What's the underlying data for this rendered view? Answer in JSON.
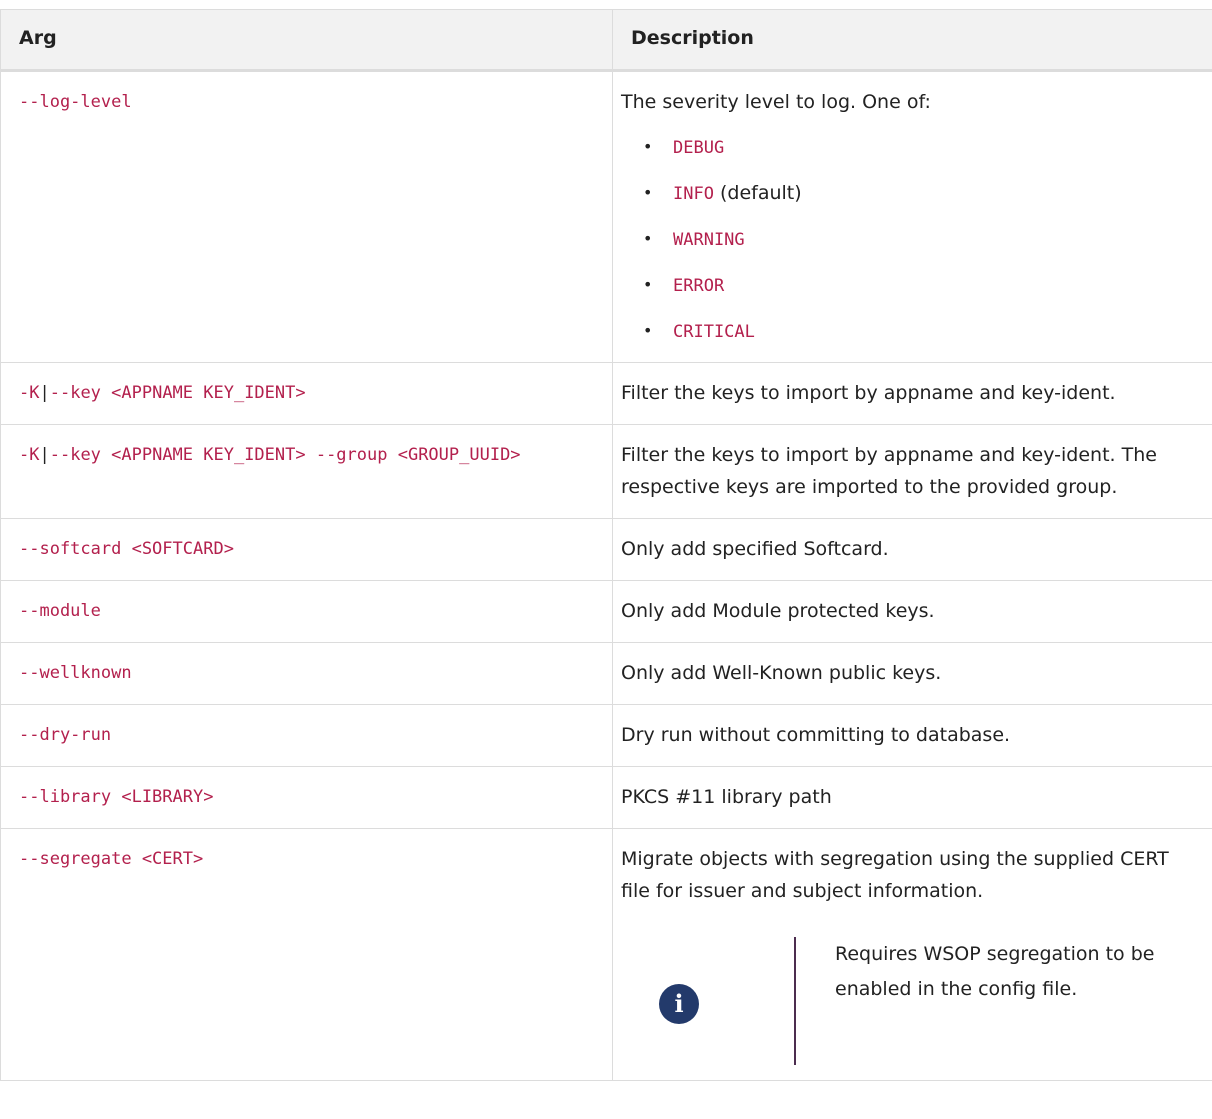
{
  "table": {
    "headers": [
      "Arg",
      "Description"
    ],
    "log_level": {
      "arg": "--log-level",
      "desc": "The severity level to log. One of:",
      "levels": [
        "DEBUG",
        "INFO",
        "WARNING",
        "ERROR",
        "CRITICAL"
      ],
      "default_suffix": " (default)"
    },
    "key_row": {
      "arg_prefix": "-K",
      "arg_sep": "|",
      "arg_rest": "--key <APPNAME KEY_IDENT>",
      "desc": "Filter the keys to import by appname and key-ident."
    },
    "key_group_row": {
      "arg_prefix": "-K",
      "arg_sep": "|",
      "arg_rest": "--key <APPNAME KEY_IDENT> --group <GROUP_UUID>",
      "desc": "Filter the keys to import by appname and key-ident. The respective keys are imported to the provided group."
    },
    "simple_rows": [
      {
        "arg": "--softcard <SOFTCARD>",
        "desc": "Only add specified Softcard."
      },
      {
        "arg": "--module",
        "desc": "Only add Module protected keys."
      },
      {
        "arg": "--wellknown",
        "desc": "Only add Well-Known public keys."
      },
      {
        "arg": "--dry-run",
        "desc": "Dry run without committing to database."
      },
      {
        "arg": "--library <LIBRARY>",
        "desc": "PKCS #11 library path"
      }
    ],
    "segregate_row": {
      "arg": "--segregate <CERT>",
      "desc": "Migrate objects with segregation using the supplied CERT file for issuer and subject information.",
      "note_icon": "info-icon",
      "note_icon_glyph": "i",
      "note": "Requires WSOP segregation to be enabled in the config file."
    }
  },
  "colors": {
    "code": "#b3204d",
    "header_bg": "#f2f2f2",
    "border": "#dcdcdc",
    "note_icon_bg": "#233a6b",
    "note_divider": "#4c2d4f"
  }
}
